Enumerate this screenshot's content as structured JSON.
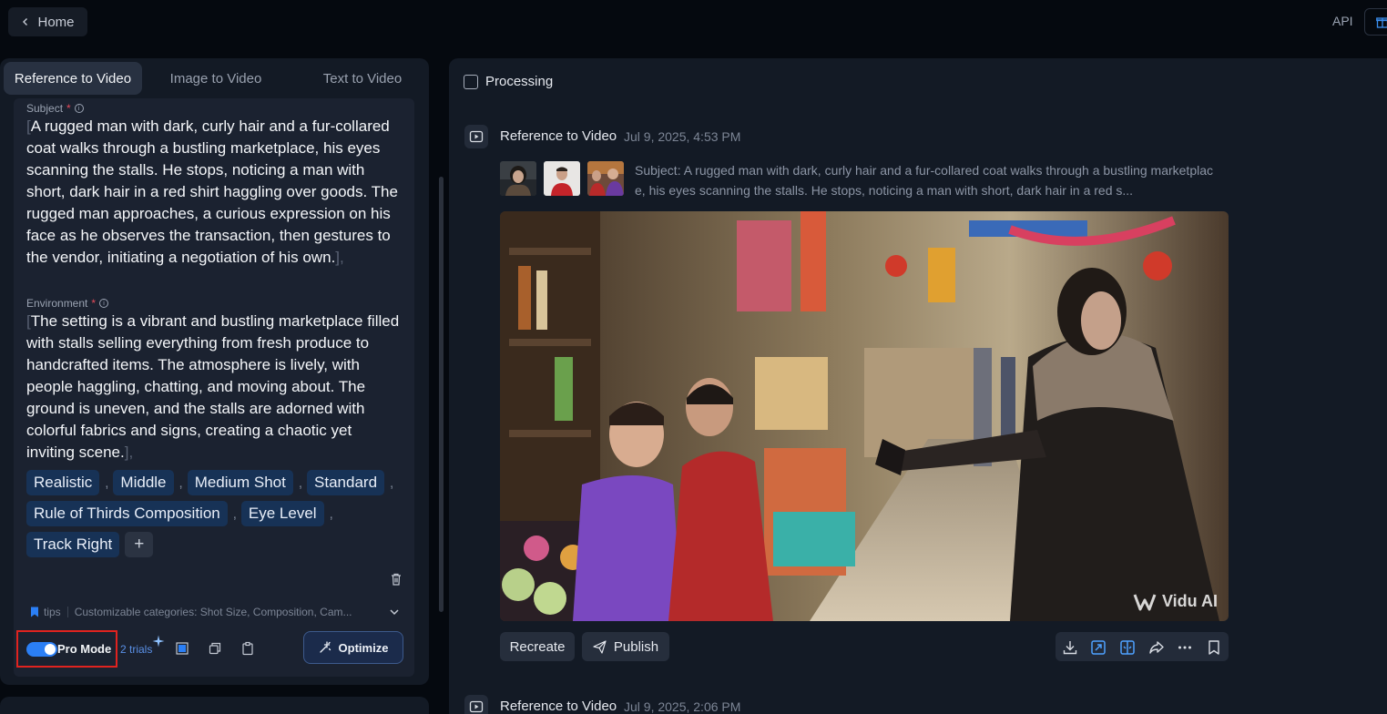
{
  "header": {
    "home_label": "Home",
    "api_label": "API"
  },
  "tabs": [
    {
      "label": "Reference to Video",
      "active": true
    },
    {
      "label": "Image to Video",
      "active": false
    },
    {
      "label": "Text to Video",
      "active": false
    }
  ],
  "prompt": {
    "subject": {
      "label": "Subject",
      "required_mark": "*",
      "open_bracket": "[",
      "text": "A rugged man with dark, curly hair and a fur-collared coat walks through a bustling marketplace, his eyes scanning the stalls. He stops, noticing a man with short, dark hair in a red shirt haggling over goods. The rugged man approaches, a curious expression on his face as he observes the transaction, then gestures to the vendor, initiating a negotiation of his own.",
      "close_bracket": "],"
    },
    "environment": {
      "label": "Environment",
      "required_mark": "*",
      "open_bracket": "[",
      "text": "The setting is a vibrant and bustling marketplace filled with stalls selling everything from fresh produce to handcrafted items. The atmosphere is lively, with people haggling, chatting, and moving about. The ground is uneven, and the stalls are adorned with colorful fabrics and signs, creating a chaotic yet inviting scene.",
      "close_bracket": "],"
    },
    "chips": [
      "Realistic",
      "Middle",
      "Medium Shot",
      "Standard",
      "Rule of Thirds Composition",
      "Eye Level",
      "Track Right"
    ],
    "chip_separator": ",",
    "add_chip_label": "+",
    "tips_label": "tips",
    "tips_categories": "Customizable categories: Shot Size, Composition, Cam..."
  },
  "controls": {
    "pro_mode_label": "Pro Mode",
    "pro_mode_on": true,
    "trials_label": "2 trials",
    "optimize_label": "Optimize"
  },
  "feed": {
    "filter_label": "Processing",
    "filter_checked": false,
    "entries": [
      {
        "type": "Reference to Video",
        "date": "Jul 9, 2025, 4:53 PM",
        "prompt_preview": "Subject: A rugged man with dark, curly hair and a fur-collared coat walks through a bustling marketplace, his eyes scanning the stalls. He stops, noticing a man with short, dark hair in a red s...",
        "watermark": "Vidu AI",
        "recreate_label": "Recreate",
        "publish_label": "Publish"
      },
      {
        "type": "Reference to Video",
        "date": "Jul 9, 2025, 2:06 PM"
      }
    ]
  },
  "colors": {
    "accent": "#2b7ff5",
    "chip_bg": "#173256",
    "highlight_box": "#e0231f",
    "panel_bg": "#131a25"
  },
  "icons": [
    "chevron-left-icon",
    "gift-icon",
    "info-icon",
    "trash-icon",
    "bookmark-icon",
    "chevron-down-icon",
    "sparkle-icon",
    "image-icon",
    "copy-icon",
    "clipboard-icon",
    "magic-wand-icon",
    "video-icon",
    "send-icon",
    "download-icon",
    "expand-icon",
    "split-icon",
    "share-icon",
    "more-icon",
    "save-icon"
  ]
}
